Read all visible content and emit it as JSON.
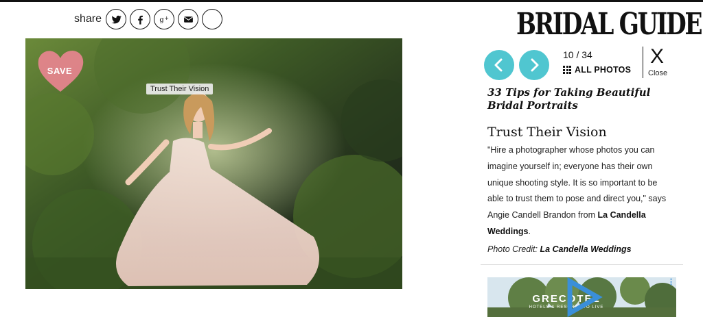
{
  "share": {
    "label": "share",
    "icons": [
      "twitter-icon",
      "facebook-icon",
      "google-plus-icon",
      "email-icon",
      "more-icon"
    ]
  },
  "photo": {
    "save_label": "SAVE",
    "tooltip": "Trust Their Vision",
    "save_color": "#e8848f"
  },
  "brand": {
    "logo": "BRIDAL GUIDE"
  },
  "gallery": {
    "counter": "10 / 34",
    "all_photos_label": "ALL PHOTOS",
    "close_symbol": "X",
    "close_label": "Close",
    "nav_color": "#50c6d0",
    "title": "33 Tips for Taking Beautiful Bridal Portraits"
  },
  "slide": {
    "title": "Trust Their Vision",
    "caption_text": "\"Hire a photographer whose photos you can imagine yourself in; everyone has their own unique shooting style. It is so important to be able to trust them to pose and direct you,\" says Angie Candell Brandon from ",
    "caption_link": "La Candella Weddings",
    "caption_end": ".",
    "credit_label": "Photo Credit: ",
    "credit_value": "La Candella Weddings"
  },
  "ad": {
    "brand": "GRECOTEL",
    "tagline": "HOTELS & RESORTS TO LIVE"
  }
}
